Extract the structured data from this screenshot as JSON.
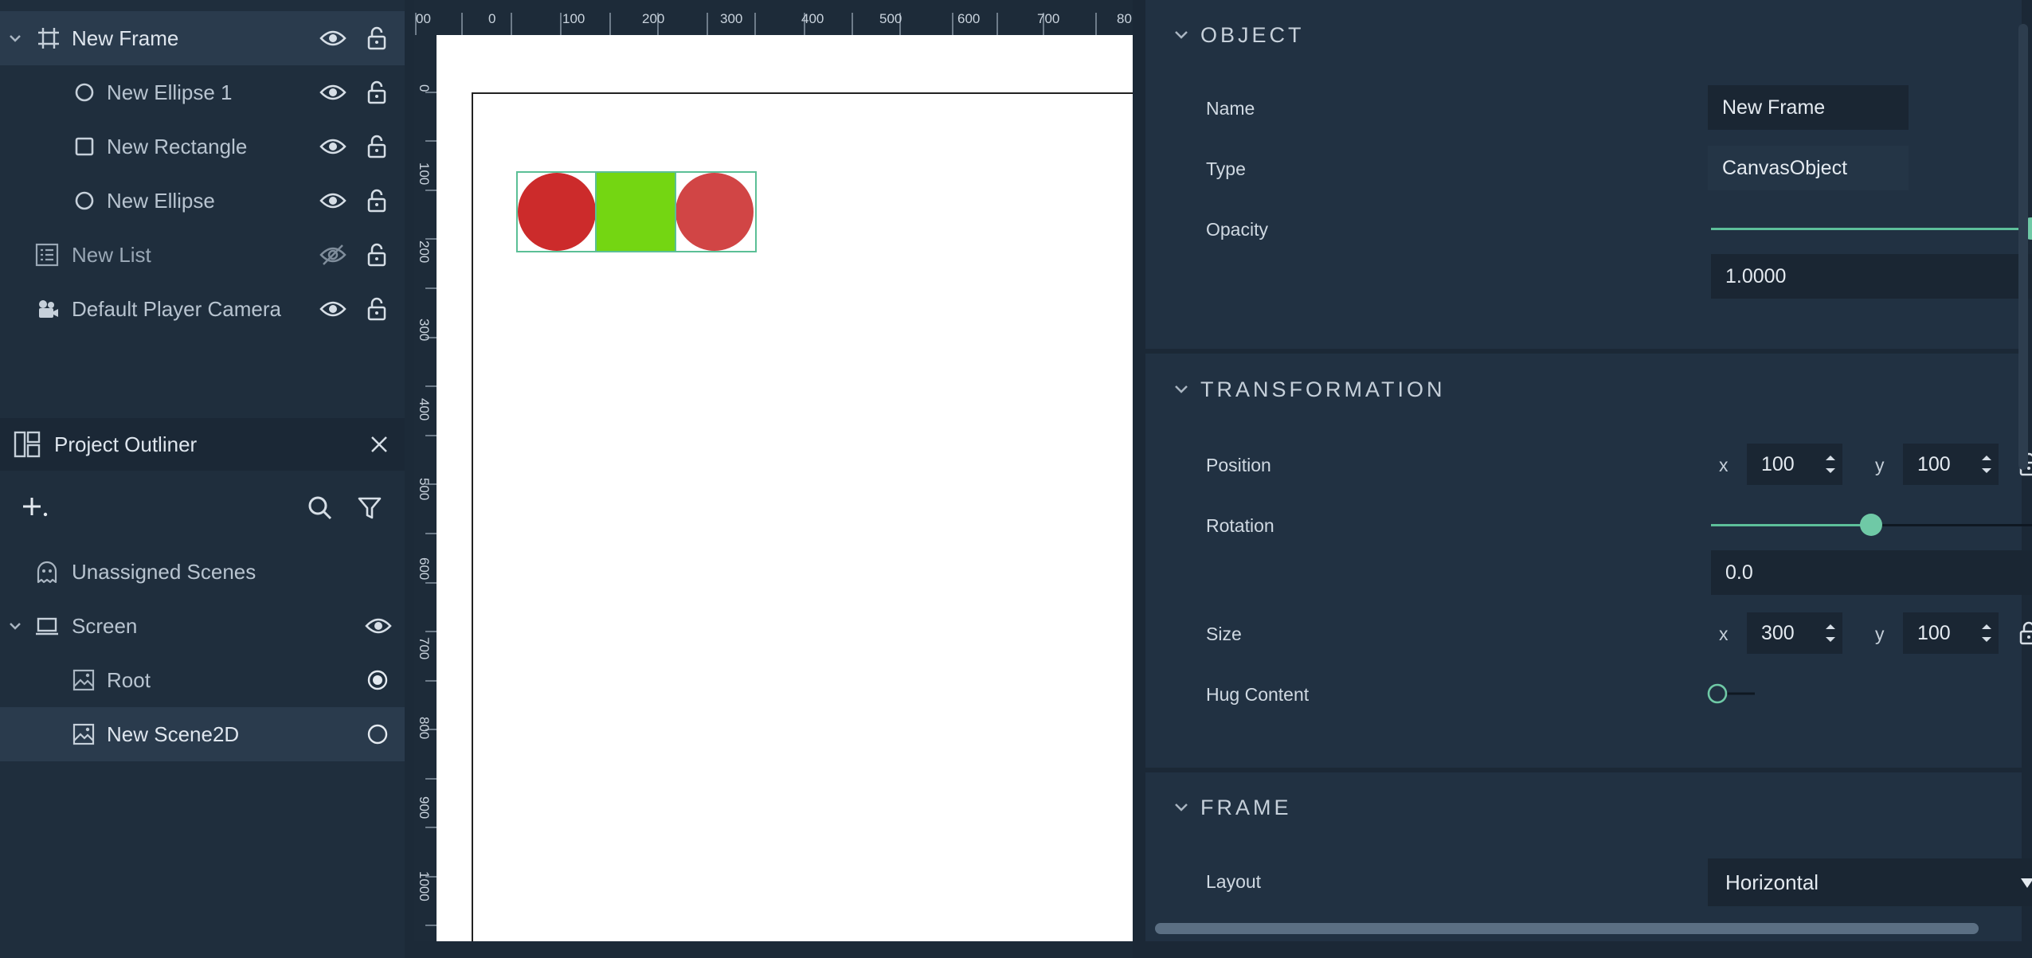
{
  "hierarchy": {
    "items": [
      {
        "label": "New Frame"
      },
      {
        "label": "New Ellipse 1"
      },
      {
        "label": "New Rectangle"
      },
      {
        "label": "New Ellipse"
      },
      {
        "label": "New List"
      },
      {
        "label": "Default Player Camera"
      }
    ]
  },
  "outliner": {
    "title": "Project Outliner",
    "items": [
      {
        "label": "Unassigned Scenes"
      },
      {
        "label": "Screen"
      },
      {
        "label": "Root"
      },
      {
        "label": "New Scene2D"
      }
    ]
  },
  "canvas": {
    "ruler_top": [
      "00",
      "0",
      "100",
      "200",
      "300",
      "400",
      "500",
      "600",
      "700",
      "80"
    ],
    "ruler_left": [
      "0",
      "100",
      "200",
      "300",
      "400",
      "500",
      "600",
      "700",
      "800",
      "900",
      "1000"
    ],
    "shape_colors": {
      "ellipse_left": "#cc2b2b",
      "rectangle": "#74d612",
      "ellipse_right": "#d14545"
    }
  },
  "inspector": {
    "object": {
      "title": "OBJECT",
      "name_label": "Name",
      "name_value": "New Frame",
      "type_label": "Type",
      "type_value": "CanvasObject",
      "opacity_label": "Opacity",
      "opacity_value": "1.0000",
      "opacity_level": 1.0
    },
    "transformation": {
      "title": "TRANSFORMATION",
      "position_label": "Position",
      "position_x": "100",
      "position_y": "100",
      "rotation_label": "Rotation",
      "rotation_value": "0.0",
      "rotation_level": 0.5,
      "size_label": "Size",
      "size_x": "300",
      "size_y": "100",
      "hug_label": "Hug Content",
      "x_label": "x",
      "y_label": "y"
    },
    "frame": {
      "title": "FRAME",
      "layout_label": "Layout",
      "layout_value": "Horizontal"
    }
  },
  "colors": {
    "accent": "#5dbf9a",
    "panel": "#213142",
    "background": "#1b2836"
  }
}
